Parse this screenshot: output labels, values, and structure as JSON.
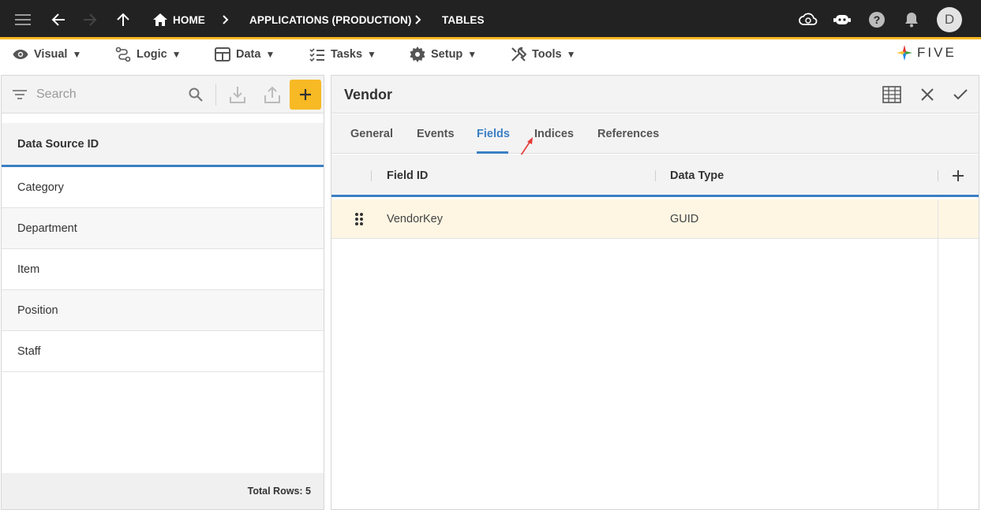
{
  "topbar": {
    "breadcrumbs": [
      "HOME",
      "APPLICATIONS (PRODUCTION)",
      "TABLES"
    ],
    "avatar_initial": "D"
  },
  "menu": {
    "items": [
      {
        "label": "Visual",
        "icon": "eye-icon"
      },
      {
        "label": "Logic",
        "icon": "logic-icon"
      },
      {
        "label": "Data",
        "icon": "table-icon"
      },
      {
        "label": "Tasks",
        "icon": "tasks-icon"
      },
      {
        "label": "Setup",
        "icon": "gear-icon"
      },
      {
        "label": "Tools",
        "icon": "tools-icon"
      }
    ],
    "caret": "▼",
    "logo_text": "FIVE"
  },
  "left": {
    "search_placeholder": "Search",
    "list_header": "Data Source ID",
    "rows": [
      "Category",
      "Department",
      "Item",
      "Position",
      "Staff"
    ],
    "footer": "Total Rows: 5"
  },
  "right": {
    "title": "Vendor",
    "tabs": [
      "General",
      "Events",
      "Fields",
      "Indices",
      "References"
    ],
    "active_tab": "Fields",
    "columns": [
      "Field ID",
      "Data Type"
    ],
    "rows": [
      {
        "field_id": "VendorKey",
        "data_type": "GUID"
      }
    ]
  },
  "colors": {
    "accent": "#f7b924",
    "active_blue": "#3b7fc4",
    "topbar": "#222222",
    "selected_row": "#fef6e3"
  }
}
